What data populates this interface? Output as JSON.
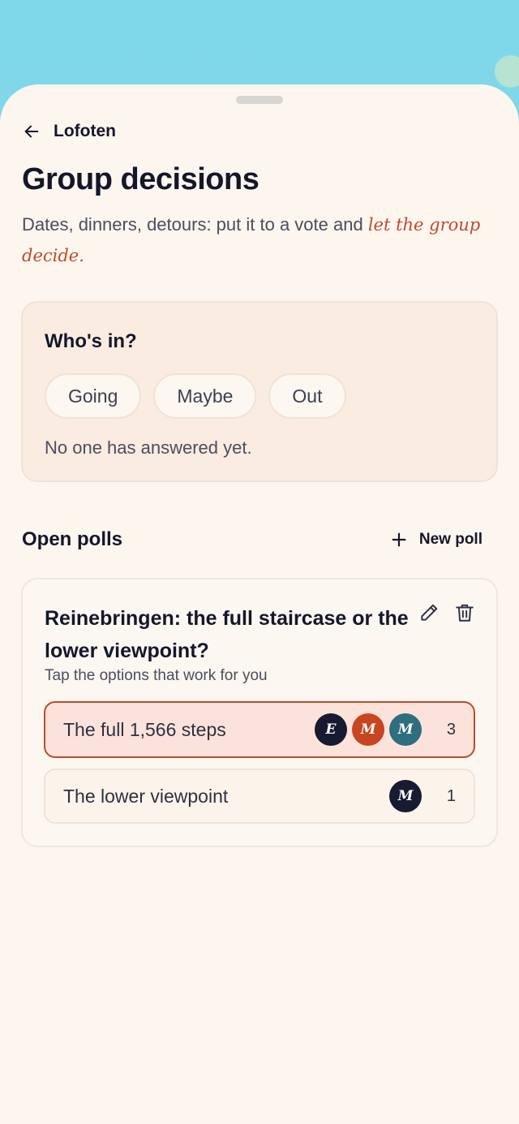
{
  "header": {
    "back_label": "Lofoten"
  },
  "page": {
    "title": "Group decisions",
    "subtitle_main": "Dates, dinners, detours: put it to a vote and ",
    "subtitle_accent": "let the group decide."
  },
  "rsvp": {
    "title": "Who's in?",
    "options": [
      "Going",
      "Maybe",
      "Out"
    ],
    "empty_text": "No one has answered yet."
  },
  "polls": {
    "section_title": "Open polls",
    "new_poll_label": "New poll",
    "items": [
      {
        "question": "Reinebringen: the full staircase or the lower viewpoint?",
        "hint": "Tap the options that work for you",
        "options": [
          {
            "label": "The full 1,566 steps",
            "voters": [
              "E",
              "M",
              "M"
            ],
            "count": "3",
            "selected": true
          },
          {
            "label": "The lower viewpoint",
            "voters": [
              "M"
            ],
            "count": "1",
            "selected": false
          }
        ]
      }
    ]
  },
  "colors": {
    "accent": "#c04a2c",
    "sheet_bg": "#fdf6ef",
    "sky": "#7fd7ea",
    "avatar_navy": "#171a30",
    "avatar_rust": "#c7451f",
    "avatar_teal": "#2e6e7e"
  },
  "icons": [
    "back-arrow-icon",
    "plus-icon",
    "pencil-icon",
    "trash-icon"
  ]
}
